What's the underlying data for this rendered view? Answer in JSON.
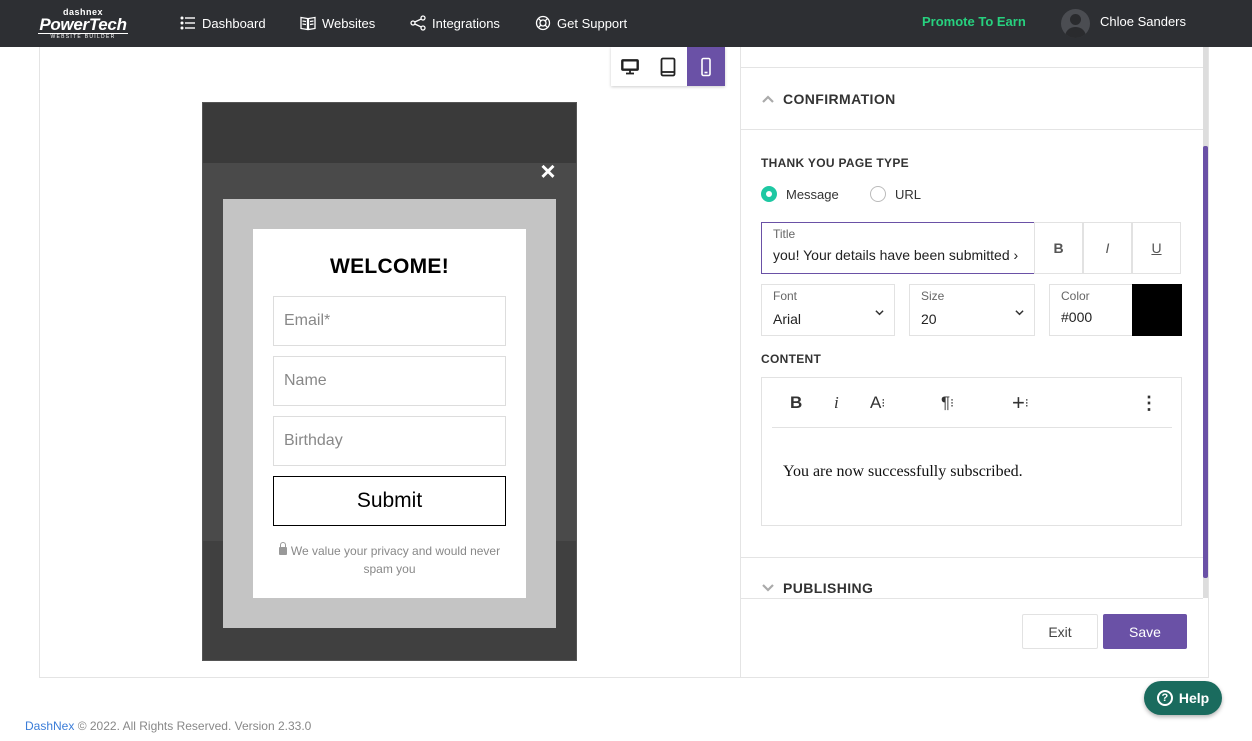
{
  "nav": {
    "logo_top": "dashnex",
    "logo_main": "PowerTech",
    "logo_sub": "WEBSITE BUILDER",
    "items": [
      {
        "label": "Dashboard",
        "icon": "list-icon"
      },
      {
        "label": "Websites",
        "icon": "book-icon"
      },
      {
        "label": "Integrations",
        "icon": "share-icon"
      },
      {
        "label": "Get Support",
        "icon": "lifebuoy-icon"
      }
    ],
    "promote": "Promote To Earn",
    "username": "Chloe Sanders"
  },
  "devices": {
    "selected": "mobile"
  },
  "popup": {
    "close": "×",
    "heading": "WELCOME!",
    "email_placeholder": "Email*",
    "name_placeholder": "Name",
    "birthday_placeholder": "Birthday",
    "submit": "Submit",
    "privacy": "We value your privacy and would never spam you"
  },
  "panel": {
    "confirmation_title": "CONFIRMATION",
    "thank_you_label": "THANK YOU PAGE TYPE",
    "radio_message": "Message",
    "radio_url": "URL",
    "title_label": "Title",
    "title_value": "‹ you! Your details have been submitted",
    "bold": "B",
    "italic": "I",
    "underline": "U",
    "font_label": "Font",
    "font_value": "Arial",
    "size_label": "Size",
    "size_value": "20",
    "color_label": "Color",
    "color_value": "#000",
    "content_label": "CONTENT",
    "content_text": "You are now successfully subscribed.",
    "publishing_title": "PUBLISHING",
    "exit": "Exit",
    "save": "Save"
  },
  "help": "Help",
  "footer": {
    "brand": "DashNex",
    "text": " © 2022. All Rights Reserved. Version 2.33.0"
  },
  "colors": {
    "accent": "#6a51a6",
    "promote": "#27d17f",
    "radio": "#1ec8a3",
    "help": "#1a6b5e"
  }
}
